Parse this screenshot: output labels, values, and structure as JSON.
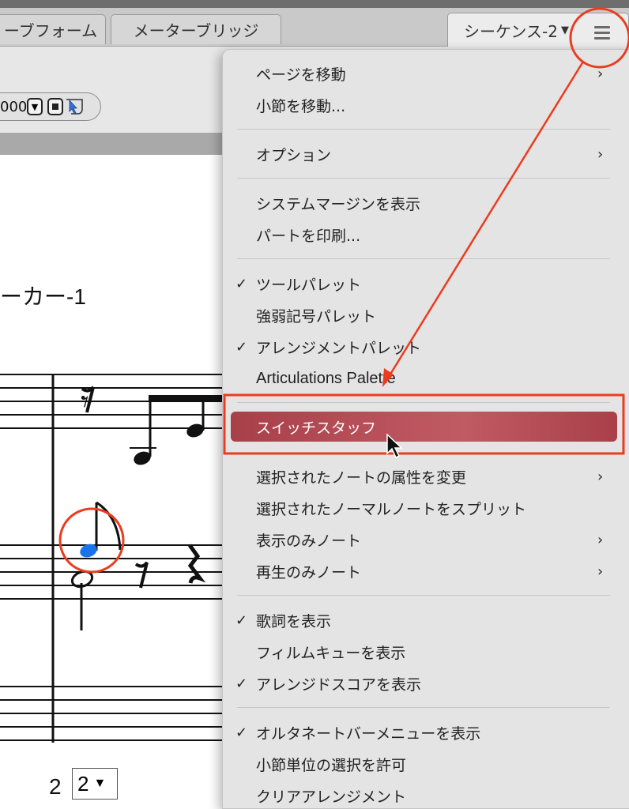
{
  "tabs": [
    {
      "label": "ーブフォーム"
    },
    {
      "label": "メーターブリッジ"
    },
    {
      "label": "シーケンス-2"
    }
  ],
  "toolbar": {
    "value": "000"
  },
  "score": {
    "part_name": "ーカー-1",
    "measure_number": "2",
    "measure_select": "2"
  },
  "menu": {
    "items": [
      {
        "label": "ページを移動",
        "checked": false,
        "submenu": true
      },
      {
        "label": "小節を移動...",
        "checked": false,
        "submenu": false
      },
      {
        "label": "オプション",
        "checked": false,
        "submenu": true
      },
      {
        "label": "システムマージンを表示",
        "checked": false,
        "submenu": false
      },
      {
        "label": "パートを印刷...",
        "checked": false,
        "submenu": false
      },
      {
        "label": "ツールパレット",
        "checked": true,
        "submenu": false
      },
      {
        "label": "強弱記号パレット",
        "checked": false,
        "submenu": false
      },
      {
        "label": "アレンジメントパレット",
        "checked": true,
        "submenu": false
      },
      {
        "label": "Articulations Palette",
        "checked": false,
        "submenu": false
      },
      {
        "label": "スイッチスタッフ",
        "checked": false,
        "submenu": false,
        "highlighted": true
      },
      {
        "label": "選択されたノートの属性を変更",
        "checked": false,
        "submenu": true
      },
      {
        "label": "選択されたノーマルノートをスプリット",
        "checked": false,
        "submenu": false
      },
      {
        "label": "表示のみノート",
        "checked": false,
        "submenu": true
      },
      {
        "label": "再生のみノート",
        "checked": false,
        "submenu": true
      },
      {
        "label": "歌詞を表示",
        "checked": true,
        "submenu": false
      },
      {
        "label": "フィルムキューを表示",
        "checked": false,
        "submenu": false
      },
      {
        "label": "アレンジドスコアを表示",
        "checked": true,
        "submenu": false
      },
      {
        "label": "オルタネートバーメニューを表示",
        "checked": true,
        "submenu": false
      },
      {
        "label": "小節単位の選択を許可",
        "checked": false,
        "submenu": false
      },
      {
        "label": "クリアアレンジメント",
        "checked": false,
        "submenu": false
      }
    ],
    "check_glyph": "✓",
    "submenu_glyph": "›"
  },
  "colors": {
    "highlight": "#b04a53",
    "annotation": "#ec3b1e",
    "selected_note": "#1a73e8"
  }
}
